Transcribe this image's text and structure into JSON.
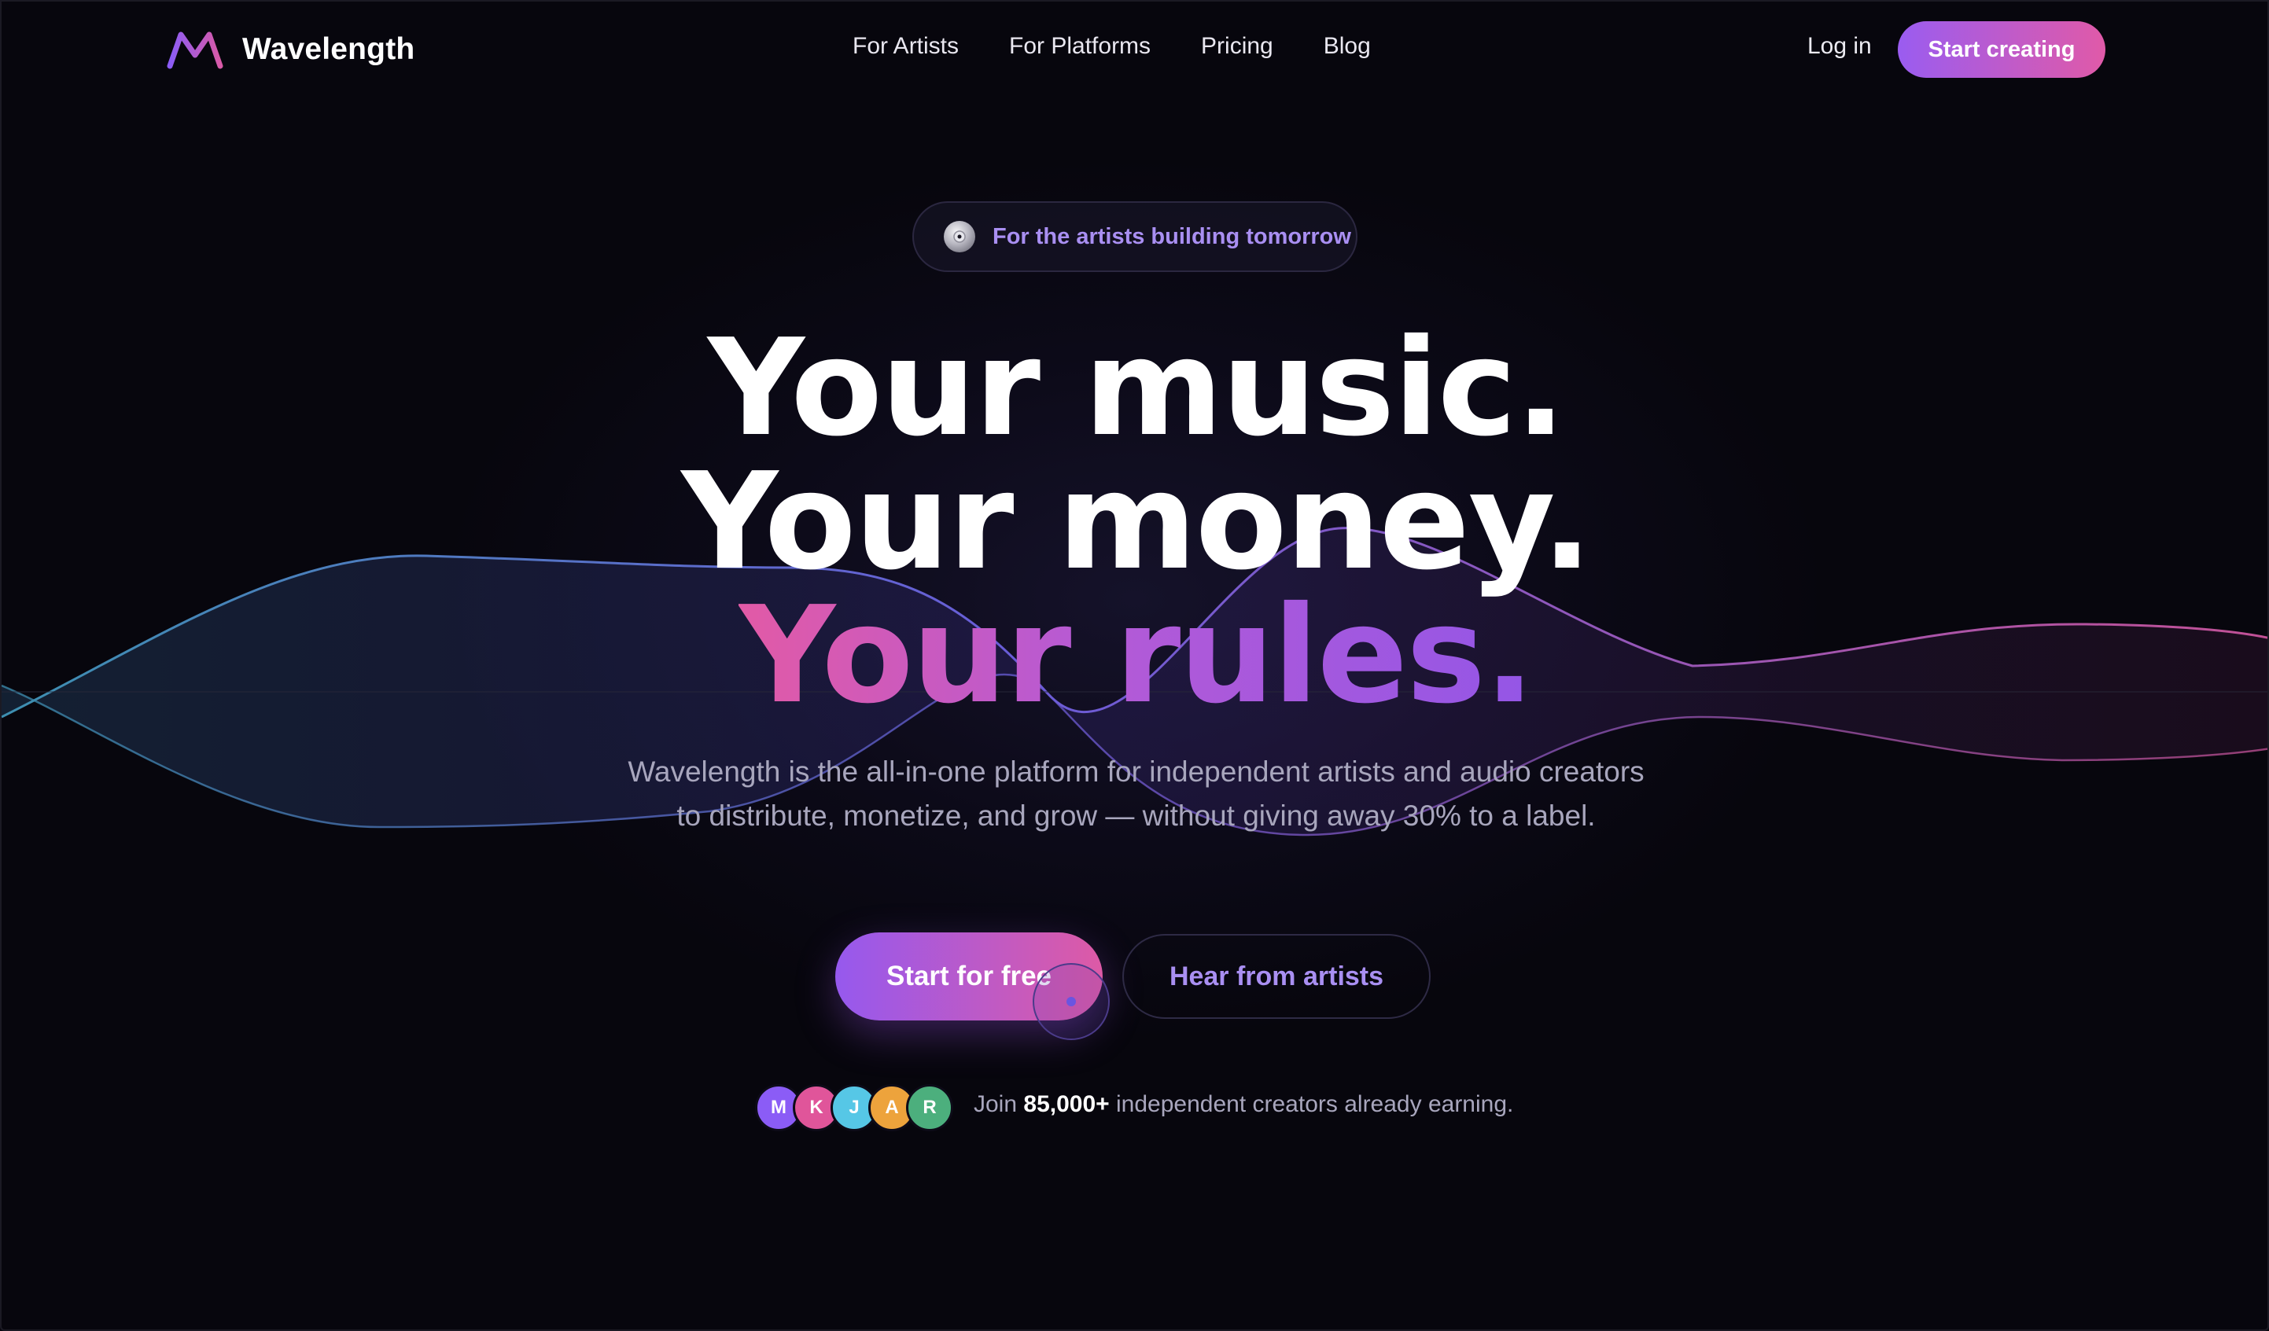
{
  "brand": {
    "name": "Wavelength",
    "accent_start": "#9a5cf0",
    "accent_end": "#e05aa8"
  },
  "nav": {
    "links": [
      {
        "label": "For Artists"
      },
      {
        "label": "For Platforms"
      },
      {
        "label": "Pricing"
      },
      {
        "label": "Blog"
      }
    ],
    "login_label": "Log in",
    "cta_label": "Start creating"
  },
  "hero": {
    "badge_icon": "disc-icon",
    "badge_text": "For the artists building tomorrow",
    "headline_line1": "Your music.",
    "headline_line2": "Your money.",
    "headline_line3": "Your rules.",
    "subtitle": "Wavelength is the all-in-one platform for independent artists and audio creators to distribute, monetize, and grow — without giving away 30% to a label.",
    "primary_cta": "Start for free",
    "secondary_cta": "Hear from artists"
  },
  "social_proof": {
    "avatars": [
      {
        "initial": "M",
        "color": "#8b5cf6"
      },
      {
        "initial": "K",
        "color": "#e0559a"
      },
      {
        "initial": "J",
        "color": "#56c7e6"
      },
      {
        "initial": "A",
        "color": "#eda33c"
      },
      {
        "initial": "R",
        "color": "#4caf7d"
      }
    ],
    "prefix": "Join",
    "count": "85,000+",
    "suffix": "independent creators already earning."
  }
}
